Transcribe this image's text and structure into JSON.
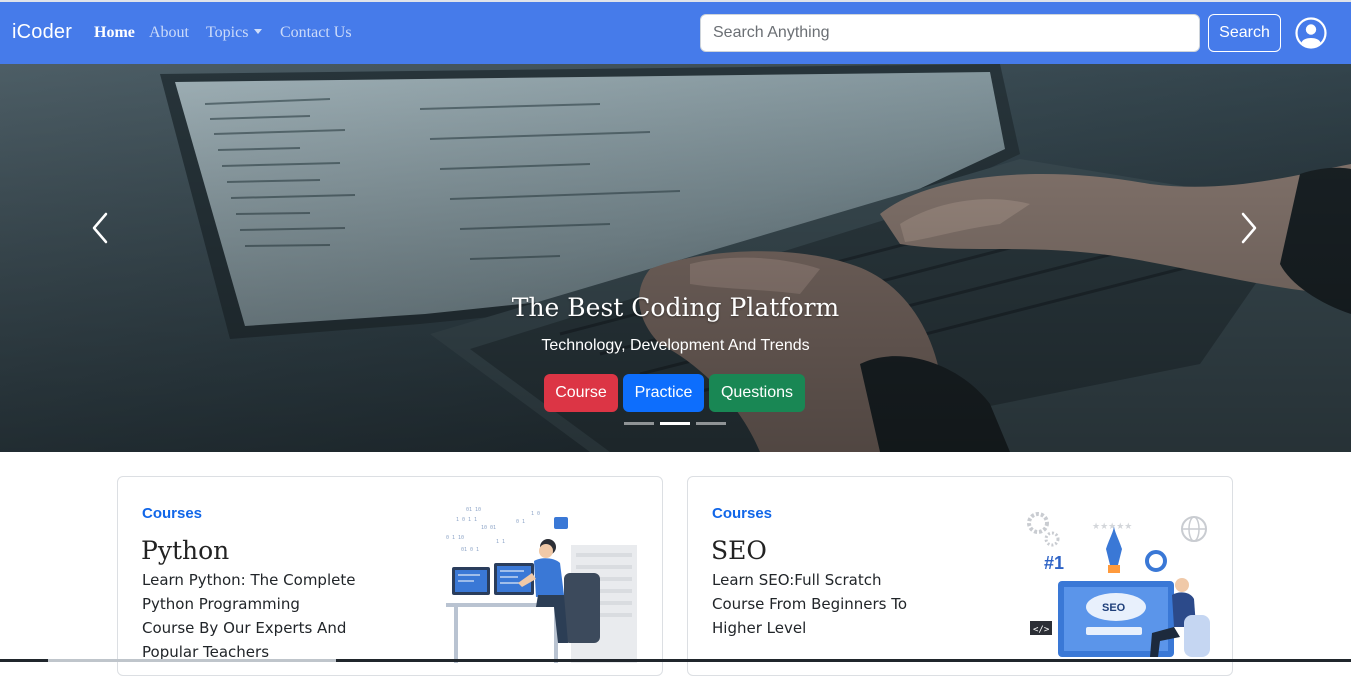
{
  "navbar": {
    "brand": "iCoder",
    "links": [
      {
        "label": "Home",
        "active": true
      },
      {
        "label": "About",
        "active": false
      },
      {
        "label": "Topics",
        "active": false,
        "dropdown": true
      },
      {
        "label": "Contact Us",
        "active": false
      }
    ],
    "search_placeholder": "Search Anything",
    "search_button": "Search",
    "avatar_icon": "user-circle-icon",
    "background_color": "#467bea"
  },
  "carousel": {
    "title": "The Best Coding Platform",
    "subtitle": "Technology, Development And Trends",
    "buttons": [
      {
        "label": "Course",
        "color": "#dc3545"
      },
      {
        "label": "Practice",
        "color": "#0d6efd"
      },
      {
        "label": "Questions",
        "color": "#198754"
      }
    ],
    "indicators": [
      false,
      true,
      false
    ],
    "prev_icon": "chevron-left-icon",
    "next_icon": "chevron-right-icon"
  },
  "cards": [
    {
      "category": "Courses",
      "title": "Python",
      "text": "Learn Python: The Complete Python Programming Course By Our Experts And Popular Teachers",
      "image": "developer-at-computer-illustration"
    },
    {
      "category": "Courses",
      "title": "SEO",
      "text": "Learn SEO:Full Scratch Course From Beginners To Higher Level",
      "image": "seo-ranking-illustration"
    }
  ],
  "colors": {
    "category_text": "#1166e8"
  }
}
